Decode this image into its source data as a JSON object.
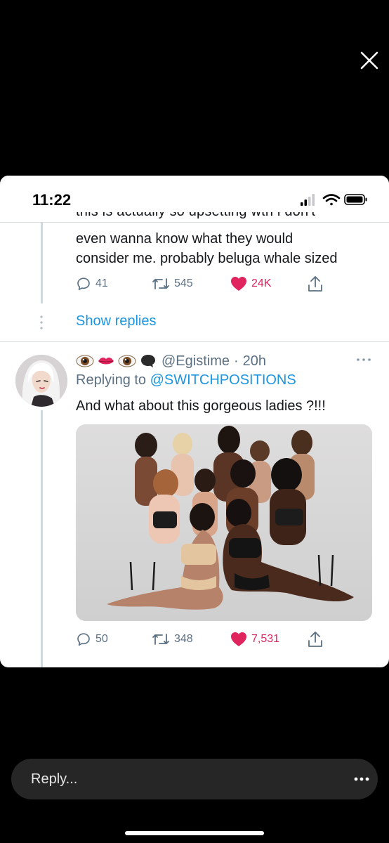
{
  "status_bar": {
    "time": "11:22",
    "icons": [
      "signal-icon",
      "wifi-icon",
      "battery-icon"
    ]
  },
  "viewer": {
    "close_icon": "close-icon"
  },
  "parent_tweet": {
    "text_cut": "this is actually so upsetting wth i don't",
    "text_lines": [
      "even wanna know what they would",
      "consider me. probably beluga whale sized"
    ],
    "actions": {
      "replies": "41",
      "retweets": "545",
      "likes": "24K"
    }
  },
  "thread": {
    "show_replies": "Show replies"
  },
  "reply_tweet": {
    "emoji_name": [
      "eye-emoji",
      "lips-emoji",
      "eye-emoji",
      "speech-bubble-emoji"
    ],
    "handle": "@Egistime",
    "separator": "·",
    "time": "20h",
    "replying_prefix": "Replying to",
    "replying_to": "@SWITCHPOSITIONS",
    "text": "And what about this gorgeous ladies ?!!!",
    "actions": {
      "replies": "50",
      "retweets": "348",
      "likes": "7,531"
    }
  },
  "composer": {
    "placeholder": "Reply...",
    "more_icon": "more-horizontal-icon"
  },
  "colors": {
    "link": "#1b95e0",
    "like": "#e0245e",
    "muted": "#5b7083",
    "text": "#14171a",
    "background": "#000000"
  }
}
